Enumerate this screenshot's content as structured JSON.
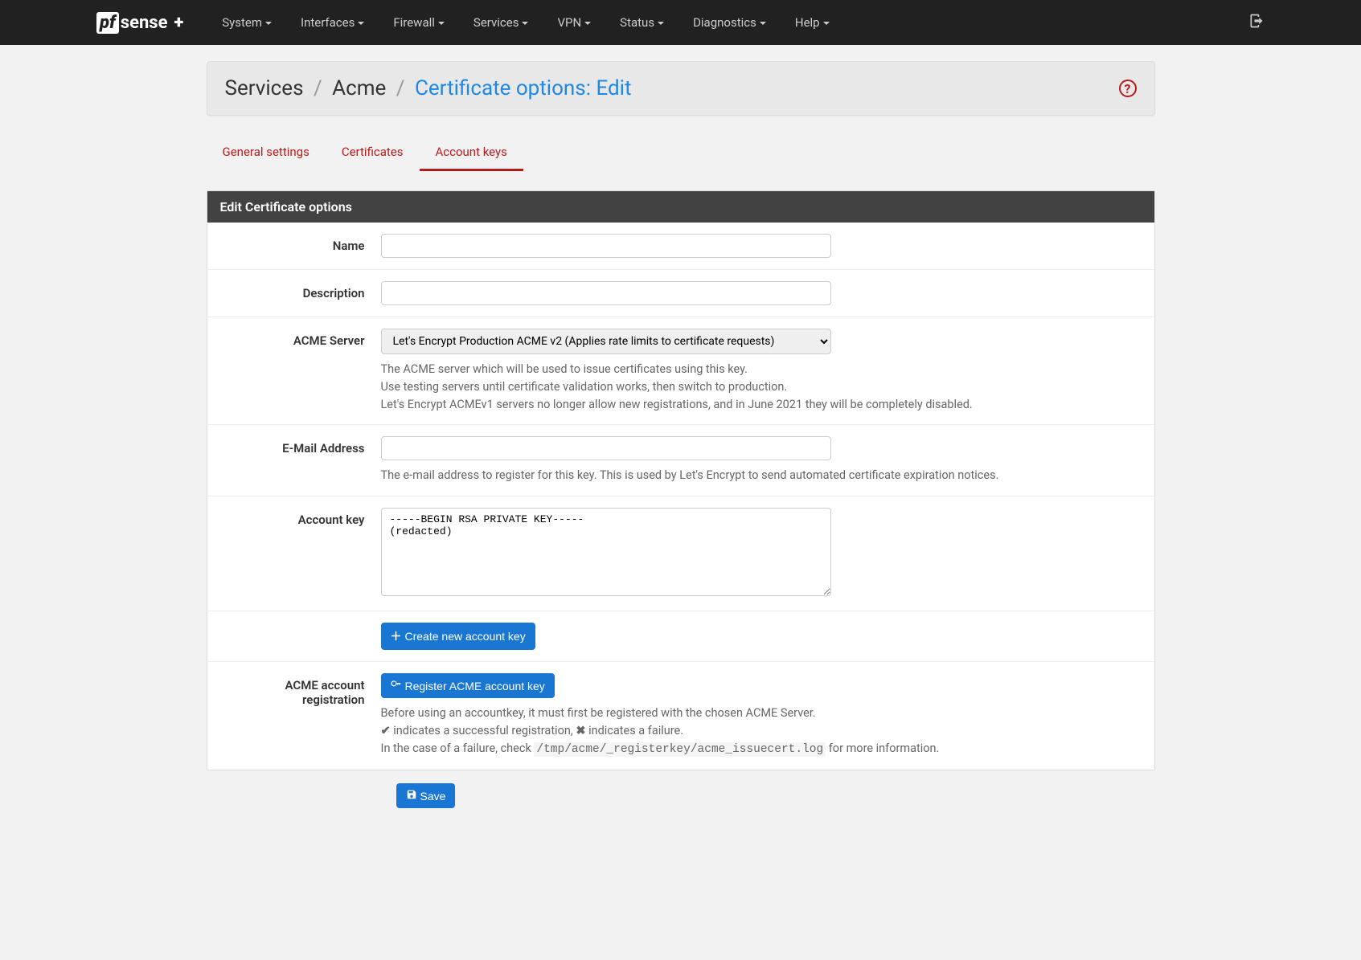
{
  "logo": {
    "prefix": "pf",
    "main": "sense",
    "suffix": "+"
  },
  "nav": [
    {
      "label": "System"
    },
    {
      "label": "Interfaces"
    },
    {
      "label": "Firewall"
    },
    {
      "label": "Services"
    },
    {
      "label": "VPN"
    },
    {
      "label": "Status"
    },
    {
      "label": "Diagnostics"
    },
    {
      "label": "Help"
    }
  ],
  "breadcrumb": {
    "part1": "Services",
    "part2": "Acme",
    "part3": "Certificate options: Edit"
  },
  "tabs": [
    {
      "label": "General settings",
      "active": false
    },
    {
      "label": "Certificates",
      "active": false
    },
    {
      "label": "Account keys",
      "active": true
    }
  ],
  "panel_title": "Edit Certificate options",
  "form": {
    "name": {
      "label": "Name",
      "value": ""
    },
    "description": {
      "label": "Description",
      "value": ""
    },
    "acme_server": {
      "label": "ACME Server",
      "value": "Let's Encrypt Production ACME v2 (Applies rate limits to certificate requests)",
      "help1": "The ACME server which will be used to issue certificates using this key.",
      "help2": "Use testing servers until certificate validation works, then switch to production.",
      "help3": "Let's Encrypt ACMEv1 servers no longer allow new registrations, and in June 2021 they will be completely disabled."
    },
    "email": {
      "label": "E-Mail Address",
      "value": "",
      "help": "The e-mail address to register for this key. This is used by Let's Encrypt to send automated certificate expiration notices."
    },
    "account_key": {
      "label": "Account key",
      "value": "-----BEGIN RSA PRIVATE KEY-----\n(redacted)\n"
    },
    "create_key_btn": "Create new account key",
    "registration": {
      "label": "ACME account registration",
      "button": "Register ACME account key",
      "help1": "Before using an accountkey, it must first be registered with the chosen ACME Server.",
      "help2a": " indicates a successful registration, ",
      "help2b": " indicates a failure.",
      "help3a": "In the case of a failure, check ",
      "help3b": "/tmp/acme/_registerkey/acme_issuecert.log",
      "help3c": " for more information."
    },
    "save_btn": "Save"
  }
}
